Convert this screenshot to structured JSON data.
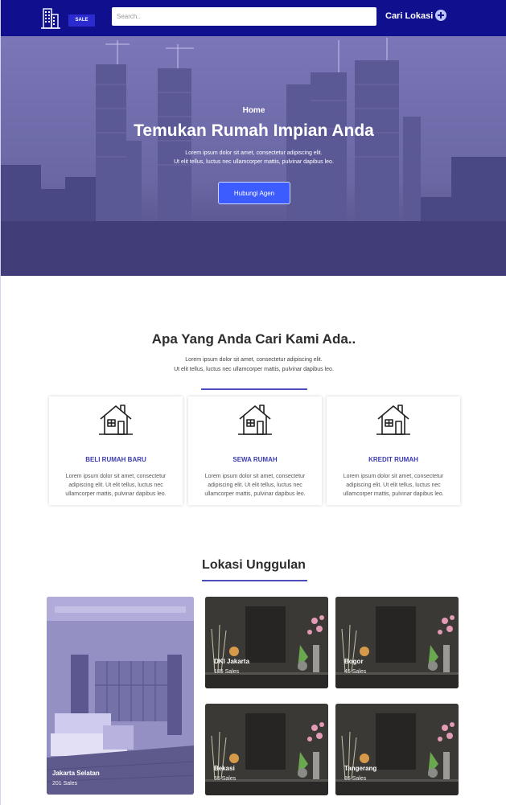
{
  "header": {
    "sale_badge": "SALE",
    "search_placeholder": "Search..",
    "location_label": "Cari Lokasi"
  },
  "hero": {
    "breadcrumb": "Home",
    "title": "Temukan Rumah Impian Anda",
    "text_line1": "Lorem ipsum dolor sit amet, consectetur adipiscing elit.",
    "text_line2": "Ut elit tellus, luctus nec ullamcorper mattis, pulvinar dapibus leo.",
    "cta_label": "Hubungi Agen"
  },
  "services": {
    "title": "Apa Yang Anda Cari Kami Ada..",
    "text_line1": "Lorem ipsum dolor sit amet, consectetur adipiscing elit.",
    "text_line2": "Ut elit tellus, luctus nec ullamcorper mattis, pulvinar dapibus leo.",
    "cards": [
      {
        "title": "BELI RUMAH BARU",
        "text": "Lorem ipsum dolor sit amet, consectetur adipiscing elit. Ut elit tellus, luctus nec ullamcorper mattis, pulvinar dapibus leo."
      },
      {
        "title": "SEWA RUMAH",
        "text": "Lorem ipsum dolor sit amet, consectetur adipiscing elit. Ut elit tellus, luctus nec ullamcorper mattis, pulvinar dapibus leo."
      },
      {
        "title": "KREDIT RUMAH",
        "text": "Lorem ipsum dolor sit amet, consectetur adipiscing elit. Ut elit tellus, luctus nec ullamcorper mattis, pulvinar dapibus leo."
      }
    ]
  },
  "locations": {
    "title": "Lokasi Unggulan",
    "items": [
      {
        "name": "Jakarta Selatan",
        "sales": "201 Sales"
      },
      {
        "name": "DKI Jakarta",
        "sales": "185 Sales"
      },
      {
        "name": "Bogor",
        "sales": "45 Sales"
      },
      {
        "name": "Bekasi",
        "sales": "55 Sales"
      },
      {
        "name": "Tangerang",
        "sales": "85 Sales"
      }
    ]
  },
  "colors": {
    "header_bg": "#10108e",
    "accent": "#3d5cff",
    "card_title": "#3b3bb0"
  },
  "icons": [
    "building-logo-icon",
    "plus-circle-icon",
    "house-icon"
  ]
}
